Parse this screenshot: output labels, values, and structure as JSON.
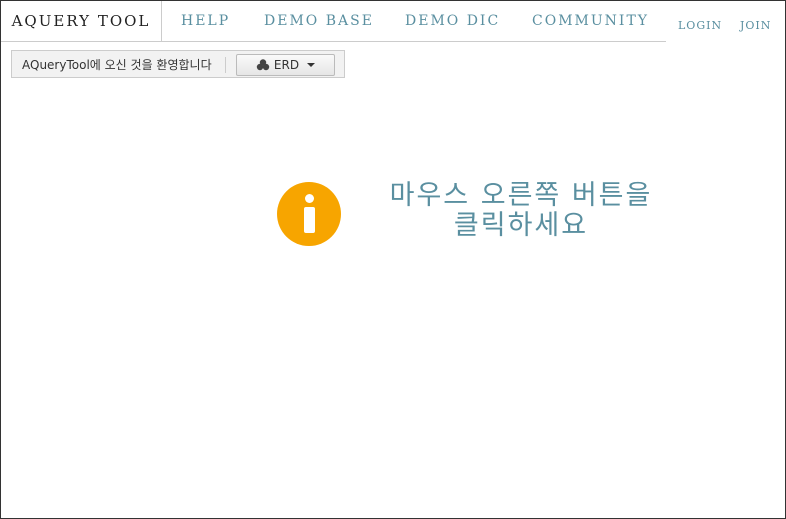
{
  "nav": {
    "brand": "AQUERY TOOL",
    "links": [
      "HELP",
      "DEMO BASE",
      "DEMO DIC",
      "COMMUNITY"
    ],
    "login": "LOGIN",
    "join": "JOIN"
  },
  "toolbar": {
    "welcome": "AQueryTool에 오신 것을 환영합니다",
    "erd_label": "ERD"
  },
  "message": {
    "line1": "마우스 오른쪽 버튼을",
    "line2": "클릭하세요"
  },
  "colors": {
    "accent": "#5a8fa0",
    "info": "#f7a500"
  },
  "icons": {
    "erd": "erd-diagram-icon",
    "dropdown": "caret-down-icon",
    "info": "info-icon"
  }
}
